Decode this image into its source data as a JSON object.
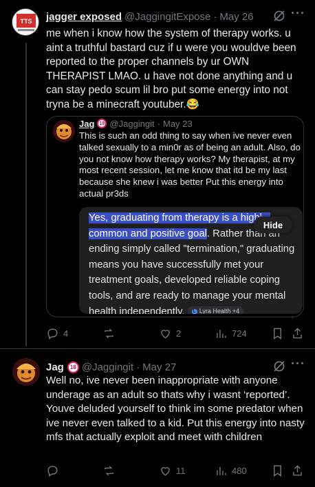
{
  "tweet1": {
    "display_name": "jagger exposed",
    "handle": "@JaggingitExpose",
    "separator": "·",
    "date": "May 26",
    "text": "me when i know how the system of therapy works. u aint a truthful bastard cuz if u were you wouldve been reported to the proper channels by ur OWN THERAPIST LMAO. u have not done anything and u can stay pedo scum lil bro put some energy into not tryna be a minecraft youtuber.😂",
    "more_label": "···",
    "quote": {
      "display_name": "Jag",
      "badge": "18",
      "handle": "@Jaggingit",
      "separator": "·",
      "date": "May 23",
      "text": "This is such an odd thing to say when ive never even talked sexually to a min0r as of being an adult. Also, do you not know how therapy works? My therapist, at my most recent session, let me know that itd be my last because she knew i was better Put this energy into actual pr3ds",
      "card": {
        "highlighted": "Yes, graduating from therapy is a highl... common and positive goal",
        "rest": ". Rather than an ending simply called \"termination,\" graduating means you have successfully met your treatment goals, developed reliable coping tools, and are ready to manage your mental health independently.",
        "source": "Lyra Health +4",
        "hide_label": "Hide"
      }
    },
    "actions": {
      "replies": "4",
      "reposts": "",
      "likes": "2",
      "views": "724"
    }
  },
  "tweet2": {
    "display_name": "Jag",
    "badge": "18",
    "handle": "@Jaggingit",
    "separator": "·",
    "date": "May 27",
    "text": "Well no, ive never been inappropriate with anyone underage as an adult so thats why i wasnt ‘reported’. Youve deluded yourself to think im some predator when ive never even talked to a kid. Put this energy into nasty mfs that actually exploit and meet with children",
    "more_label": "···",
    "actions": {
      "replies": "",
      "reposts": "",
      "likes": "11",
      "views": "480"
    }
  },
  "icons": [
    "reply-icon",
    "repost-icon",
    "like-icon",
    "views-icon",
    "bookmark-icon",
    "share-icon",
    "grok-icon",
    "more-icon"
  ],
  "colors": {
    "background": "#000000",
    "text": "#e7e9ea",
    "muted": "#71767b",
    "border": "#2f3336",
    "highlight": "#3b4fc4",
    "badge": "#e0245e"
  }
}
